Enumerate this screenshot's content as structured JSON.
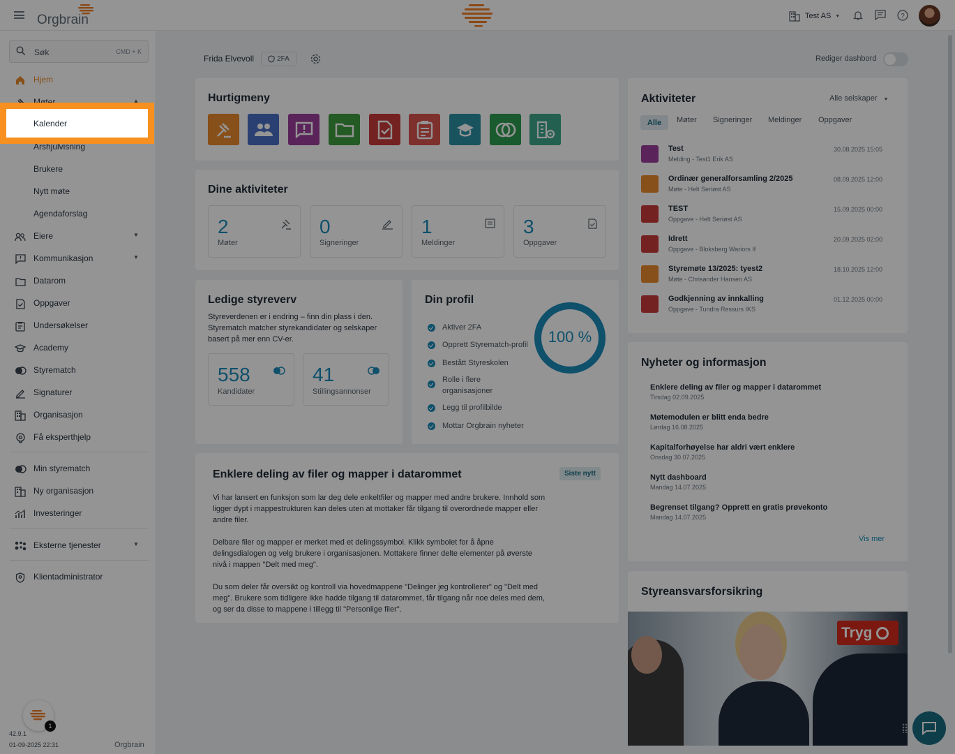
{
  "topbar": {
    "brand": "Orgbrain",
    "company": "Test AS",
    "icons": [
      "menu-icon",
      "building-icon",
      "bell-icon",
      "chat-icon",
      "help-icon",
      "avatar"
    ]
  },
  "sidebar": {
    "search_label": "Søk",
    "search_shortcut": "CMD + K",
    "items": [
      {
        "label": "Hjem",
        "icon": "home-icon"
      },
      {
        "label": "Møter",
        "icon": "gavel-icon"
      },
      {
        "label": "Kalender"
      },
      {
        "label": "Årshjulvisning"
      },
      {
        "label": "Brukere"
      },
      {
        "label": "Nytt møte"
      },
      {
        "label": "Agendaforslag"
      },
      {
        "label": "Eiere",
        "icon": "users-icon"
      },
      {
        "label": "Kommunikasjon",
        "icon": "message-icon"
      },
      {
        "label": "Datarom",
        "icon": "folder-icon"
      },
      {
        "label": "Oppgaver",
        "icon": "task-icon"
      },
      {
        "label": "Undersøkelser",
        "icon": "survey-icon"
      },
      {
        "label": "Academy",
        "icon": "academy-icon"
      },
      {
        "label": "Styrematch",
        "icon": "match-icon"
      },
      {
        "label": "Signaturer",
        "icon": "signature-icon"
      },
      {
        "label": "Organisasjon",
        "icon": "organization-icon"
      },
      {
        "label": "Få eksperthjelp",
        "icon": "expert-icon"
      },
      {
        "label": "Min styrematch",
        "icon": "match-icon"
      },
      {
        "label": "Ny organisasjon",
        "icon": "organization-icon"
      },
      {
        "label": "Investeringer",
        "icon": "chart-icon"
      },
      {
        "label": "Eksterne tjenester",
        "icon": "apps-icon"
      },
      {
        "label": "Klientadministrator",
        "icon": "shield-icon"
      }
    ],
    "version": "42.9.1",
    "build_date": "01-09-2025 22:31",
    "footer_brand": "Orgbrain",
    "badge_count": "1"
  },
  "header": {
    "user_name": "Frida Elvevoll",
    "twofa": "2FA",
    "edit_dashboard": "Rediger dashbord"
  },
  "quickmenu": {
    "title": "Hurtigmeny",
    "buttons": [
      {
        "name": "meetings",
        "color": "#e8892b"
      },
      {
        "name": "users",
        "color": "#4a6fc4"
      },
      {
        "name": "messages",
        "color": "#9b3e9b"
      },
      {
        "name": "dataroom",
        "color": "#3f9b3f"
      },
      {
        "name": "tasks",
        "color": "#c83a3a"
      },
      {
        "name": "surveys",
        "color": "#d9534f"
      },
      {
        "name": "academy",
        "color": "#2b8fa3"
      },
      {
        "name": "styrematch",
        "color": "#2e9b52"
      },
      {
        "name": "organization",
        "color": "#3da58a"
      }
    ]
  },
  "activities_summary": {
    "title": "Dine aktiviteter",
    "stats": [
      {
        "value": "2",
        "label": "Møter"
      },
      {
        "value": "0",
        "label": "Signeringer"
      },
      {
        "value": "1",
        "label": "Meldinger"
      },
      {
        "value": "3",
        "label": "Oppgaver"
      }
    ]
  },
  "board_positions": {
    "title": "Ledige styreverv",
    "text": "Styreverdenen er i endring – finn din plass i den. Styrematch matcher styrekandidater og selskaper basert på mer enn CV-er.",
    "stats": [
      {
        "value": "558",
        "label": "Kandidater"
      },
      {
        "value": "41",
        "label": "Stillingsannonser"
      }
    ]
  },
  "profile": {
    "title": "Din profil",
    "percent": "100 %",
    "progress": 1.0,
    "items": [
      "Aktiver 2FA",
      "Opprett Styrematch-profil",
      "Bestått Styreskolen",
      "Rolle i flere organisasjoner",
      "Legg til profilbilde",
      "Mottar Orgbrain nyheter"
    ]
  },
  "article": {
    "title": "Enklere deling av filer og mapper i datarommet",
    "badge": "Siste nytt",
    "paragraphs": [
      "Vi har lansert en funksjon som lar deg dele enkeltfiler og mapper med andre brukere. Innhold som ligger dypt i mappestrukturen kan deles uten at mottaker får tilgang til overordnede mapper eller andre filer.",
      "Delbare filer og mapper er merket med et delingssymbol. Klikk symbolet for å åpne delingsdialogen og velg brukere i organisasjonen. Mottakere finner delte elementer på øverste nivå i mappen \"Delt med meg\".",
      "Du som deler får oversikt og kontroll via hovedmappene \"Delinger jeg kontrollerer\" og \"Delt med meg\". Brukere som tidligere ikke hadde tilgang til datarommet, får tilgang når noe deles med dem, og ser da disse to mappene i tillegg til \"Personlige filer\"."
    ]
  },
  "activities": {
    "title": "Aktiviteter",
    "filter": "Alle selskaper",
    "tabs": [
      "Alle",
      "Møter",
      "Signeringer",
      "Meldinger",
      "Oppgaver"
    ],
    "items": [
      {
        "title": "Test",
        "sub": "Melding - Test1 Erik AS",
        "date": "30.08.2025 15:05",
        "color": "#9b3e9b"
      },
      {
        "title": "Ordinær generalforsamling 2/2025",
        "sub": "Møte - Helt Seriøst AS",
        "date": "08.09.2025 12:00",
        "color": "#e8892b"
      },
      {
        "title": "TEST",
        "sub": "Oppgave - Helt Seriøst AS",
        "date": "15.09.2025 00:00",
        "color": "#c83a3a"
      },
      {
        "title": "Idrett",
        "sub": "Oppgave - Bloksberg Wariors If",
        "date": "20.09.2025 02:00",
        "color": "#c83a3a"
      },
      {
        "title": "Styremøte 13/2025: tyest2",
        "sub": "Møte - Chrisander Hansen AS",
        "date": "18.10.2025 12:00",
        "color": "#e8892b"
      },
      {
        "title": "Godkjenning av innkalling",
        "sub": "Oppgave - Tundra Ressurs IKS",
        "date": "01.12.2025 00:00",
        "color": "#c83a3a"
      }
    ]
  },
  "news": {
    "title": "Nyheter og informasjon",
    "items": [
      {
        "title": "Enklere deling av filer og mapper i datarommet",
        "date": "Tirsdag 02.09.2025"
      },
      {
        "title": "Møtemodulen er blitt enda bedre",
        "date": "Lørdag 16.08.2025"
      },
      {
        "title": "Kapitalforhøyelse har aldri vært enklere",
        "date": "Onsdag 30.07.2025"
      },
      {
        "title": "Nytt dashboard",
        "date": "Mandag 14.07.2025"
      },
      {
        "title": "Begrenset tilgang? Opprett en gratis prøvekonto",
        "date": "Mandag 14.07.2025"
      }
    ],
    "more": "Vis mer"
  },
  "insurance": {
    "title": "Styreansvarsforsikring",
    "brand": "Tryg"
  }
}
